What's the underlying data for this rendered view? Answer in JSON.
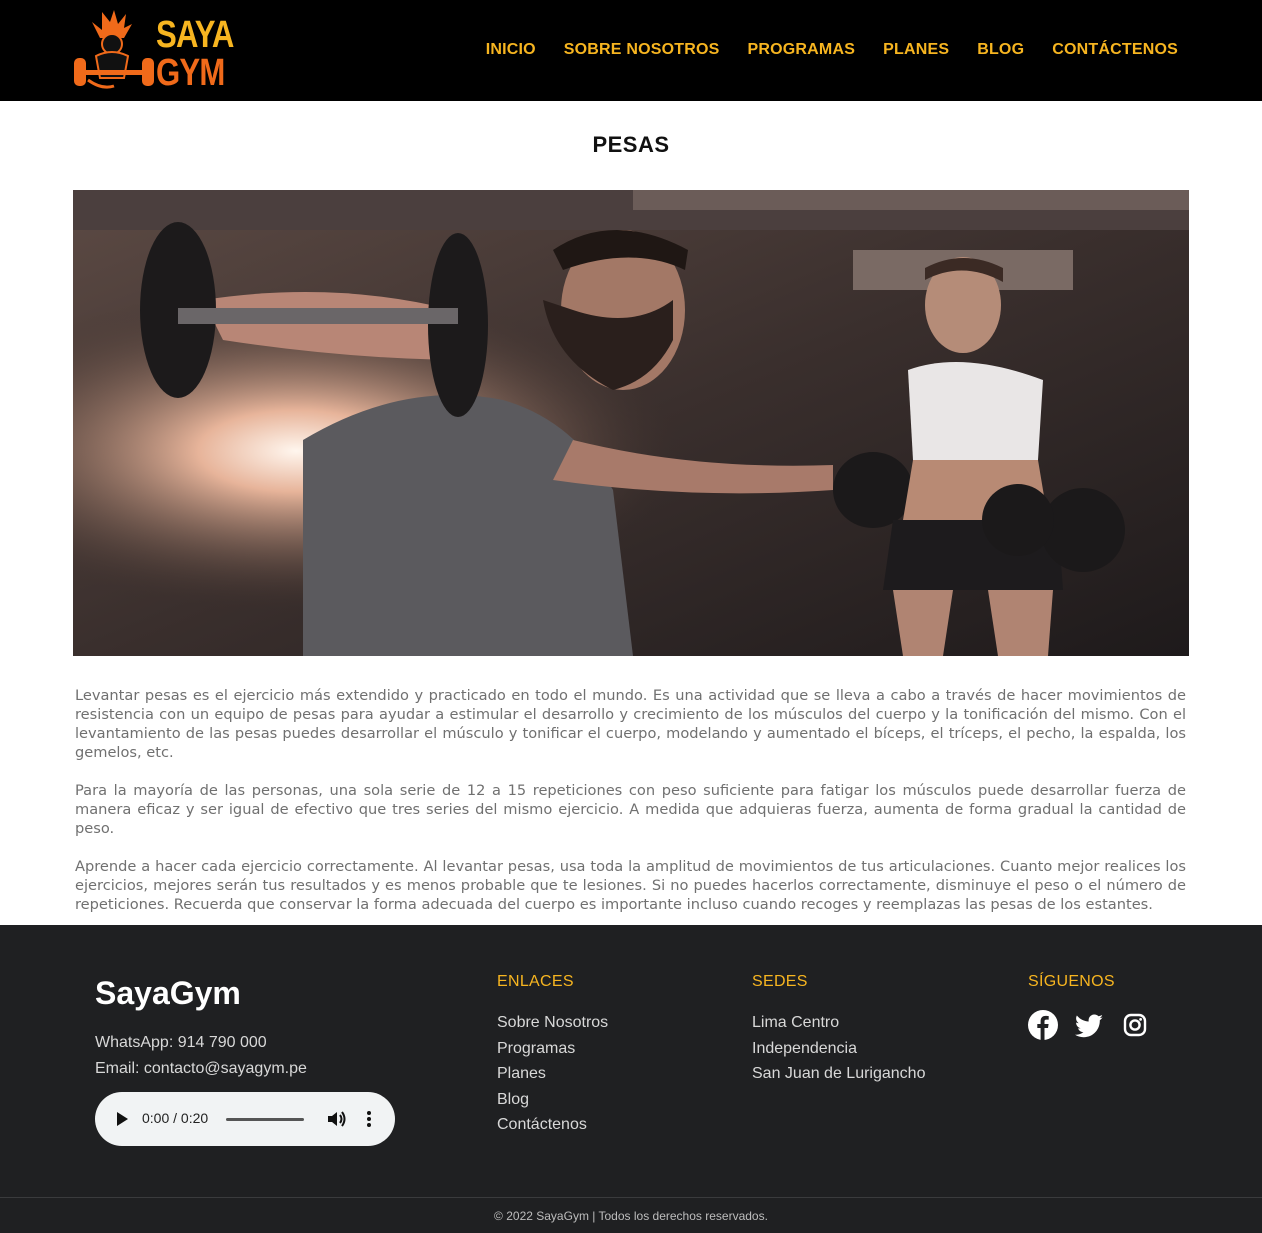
{
  "header": {
    "logo": {
      "line1": "SAYA",
      "line2": "GYM"
    },
    "nav": [
      "INICIO",
      "SOBRE NOSOTROS",
      "PROGRAMAS",
      "PLANES",
      "BLOG",
      "CONTÁCTENOS"
    ]
  },
  "main": {
    "title": "PESAS",
    "paragraphs": [
      "Levantar pesas es el ejercicio más extendido y practicado en todo el mundo. Es una actividad que se lleva a cabo a través de hacer movimientos de resistencia con un equipo de pesas para ayudar a estimular el desarrollo y crecimiento de los músculos del cuerpo y la tonificación del mismo. Con el levantamiento de las pesas puedes desarrollar el músculo y tonificar el cuerpo, modelando y aumentado el bíceps, el tríceps, el pecho, la espalda, los gemelos, etc.",
      "Para la mayoría de las personas, una sola serie de 12 a 15 repeticiones con peso suficiente para fatigar los músculos puede desarrollar fuerza de manera eficaz y ser igual de efectivo que tres series del mismo ejercicio. A medida que adquieras fuerza, aumenta de forma gradual la cantidad de peso.",
      "Aprende a hacer cada ejercicio correctamente. Al levantar pesas, usa toda la amplitud de movimientos de tus articulaciones. Cuanto mejor realices los ejercicios, mejores serán tus resultados y es menos probable que te lesiones. Si no puedes hacerlos correctamente, disminuye el peso o el número de repeticiones. Recuerda que conservar la forma adecuada del cuerpo es importante incluso cuando recoges y reemplazas las pesas de los estantes."
    ]
  },
  "footer": {
    "brand": "SayaGym",
    "whatsapp": "WhatsApp: 914 790 000",
    "email": "Email: contacto@sayagym.pe",
    "audio": {
      "time": "0:00 / 0:20"
    },
    "enlaces": {
      "title": "ENLACES",
      "items": [
        "Sobre Nosotros",
        "Programas",
        "Planes",
        "Blog",
        "Contáctenos"
      ]
    },
    "sedes": {
      "title": "SEDES",
      "items": [
        "Lima Centro",
        "Independencia",
        "San Juan de Lurigancho"
      ]
    },
    "siguenos": {
      "title": "SÍGUENOS",
      "icons": [
        "facebook-icon",
        "twitter-icon",
        "instagram-icon"
      ]
    },
    "copyright": "© 2022 SayaGym | Todos los derechos reservados."
  },
  "colors": {
    "accent": "#f7b520",
    "header_bg": "#000000",
    "footer_bg": "#1f2022"
  }
}
